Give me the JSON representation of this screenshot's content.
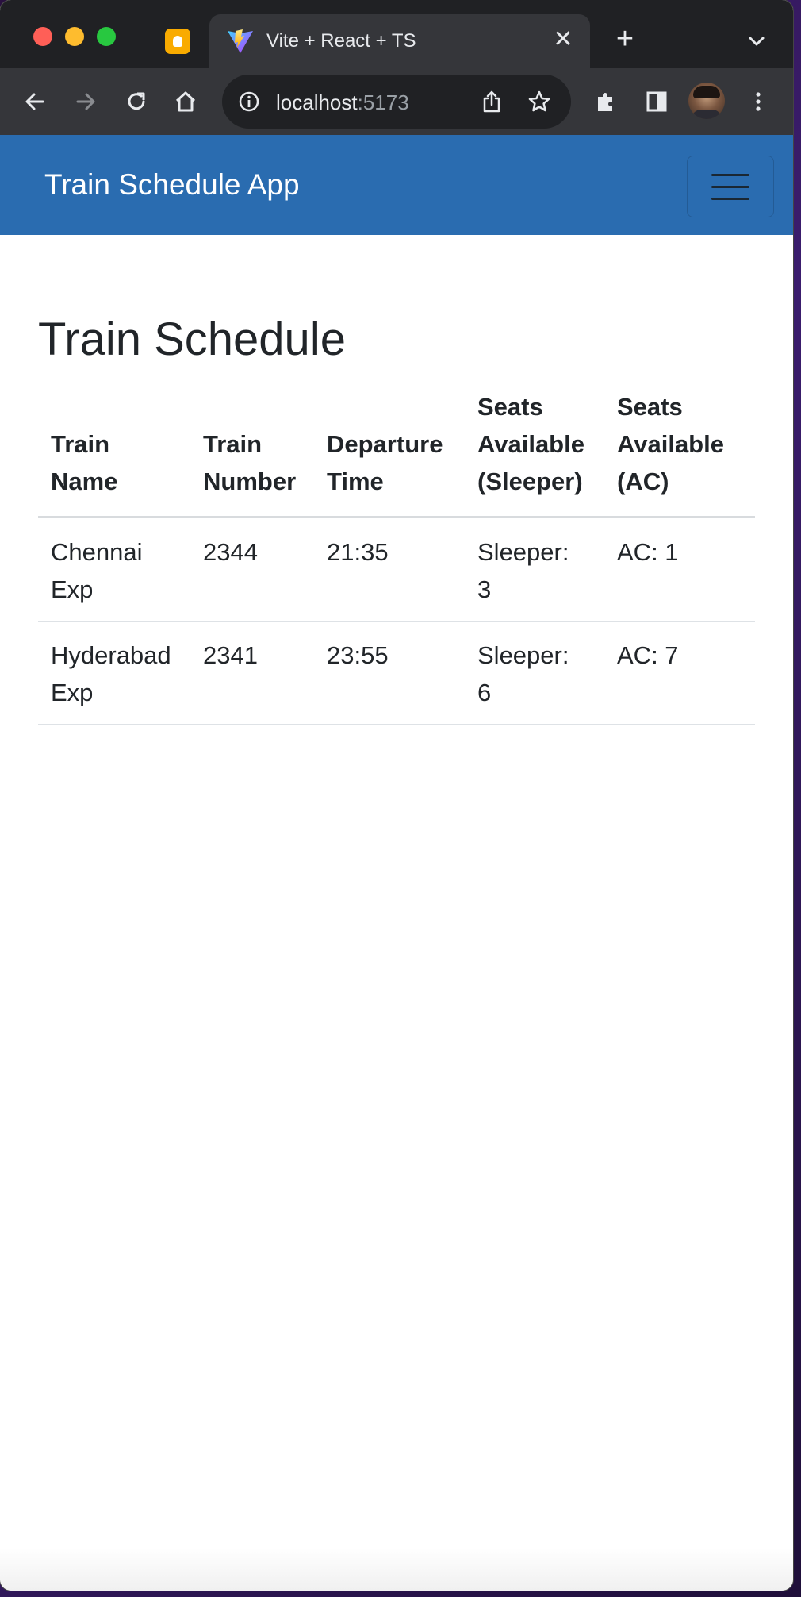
{
  "browser": {
    "tab": {
      "title": "Vite + React + TS",
      "close_glyph": "✕"
    },
    "new_tab_glyph": "+",
    "omnibox": {
      "host": "localhost",
      "port": ":5173"
    },
    "icons": {
      "back": "back-arrow-icon",
      "forward": "forward-arrow-icon",
      "reload": "reload-icon",
      "home": "home-icon",
      "info": "info-icon",
      "share": "share-icon",
      "bookmark": "star-icon",
      "extensions": "puzzle-icon",
      "side_panel": "side-panel-icon",
      "menu": "kebab-menu-icon",
      "tab_search": "chevron-down-icon"
    }
  },
  "navbar": {
    "brand": "Train Schedule App",
    "color": "#2a6cb0"
  },
  "main": {
    "title": "Train Schedule",
    "table": {
      "headers": [
        [
          "Train",
          "Name"
        ],
        [
          "Train",
          "Number"
        ],
        [
          "Departure",
          "Time"
        ],
        [
          "Seats",
          "Available",
          "(Sleeper)"
        ],
        [
          "Seats",
          "Available",
          "(AC)"
        ]
      ],
      "rows": [
        {
          "name": [
            "Chennai",
            "Exp"
          ],
          "number": "2344",
          "departure": "21:35",
          "sleeper": [
            "Sleeper:",
            "3"
          ],
          "ac": "AC: 1"
        },
        {
          "name": [
            "Hyderabad",
            "Exp"
          ],
          "number": "2341",
          "departure": "23:55",
          "sleeper": [
            "Sleeper:",
            "6"
          ],
          "ac": "AC: 7"
        }
      ]
    }
  }
}
